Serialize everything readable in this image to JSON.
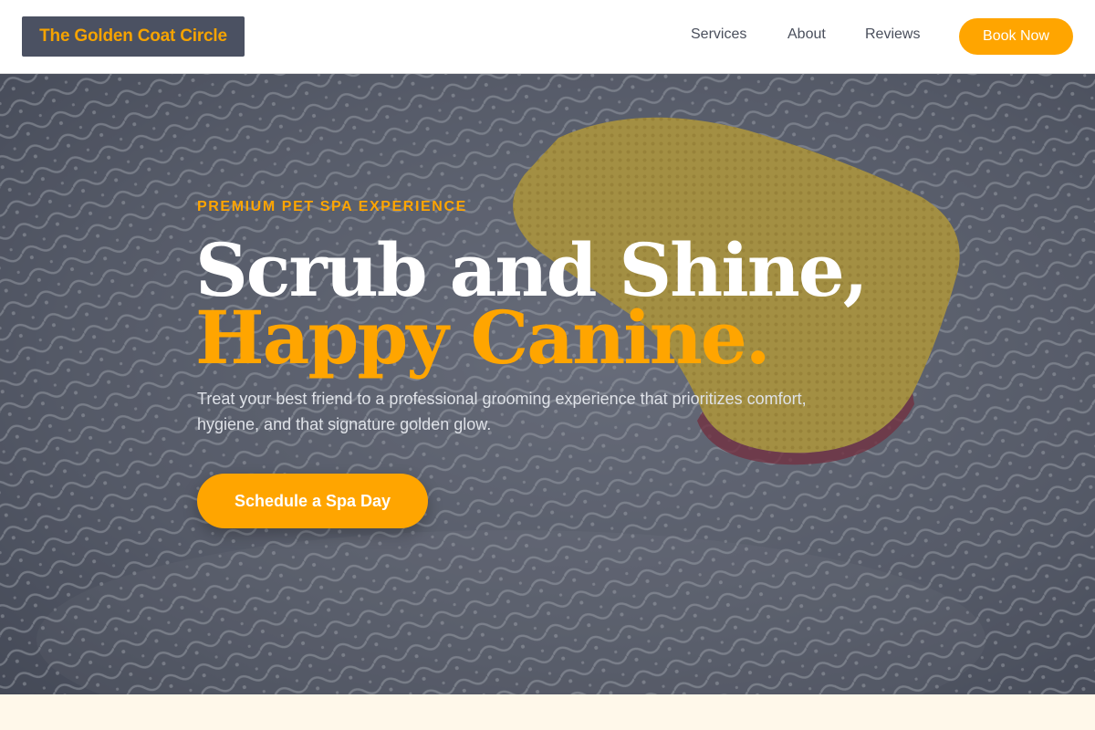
{
  "brand": {
    "name": "The Golden Coat Circle"
  },
  "nav": {
    "items": [
      {
        "label": "Services"
      },
      {
        "label": "About"
      },
      {
        "label": "Reviews"
      }
    ],
    "cta_label": "Book Now"
  },
  "hero": {
    "eyebrow": "PREMIUM PET SPA EXPERIENCE",
    "headline_line1": "Scrub and Shine,",
    "headline_line2": "Happy Canine.",
    "description": "Treat your best friend to a professional grooming experience that prioritizes comfort, hygiene, and that signature golden glow.",
    "cta_label": "Schedule a Spa Day",
    "background_image": "sponge-on-soapy-surface"
  },
  "colors": {
    "accent": "#ffa500",
    "nav_bg": "#ffffff",
    "logo_bg": "#4b5162",
    "nav_text": "#4a4f5c",
    "hero_text": "#ffffff",
    "section_bg": "#fff8ea"
  }
}
